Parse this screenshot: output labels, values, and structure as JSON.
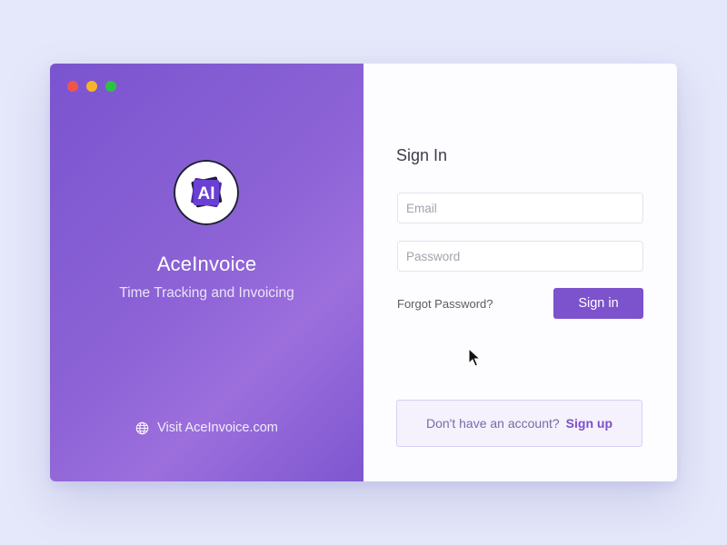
{
  "brand": {
    "app_name": "AceInvoice",
    "tagline": "Time Tracking and Invoicing",
    "logo_text": "AI",
    "visit_link": "Visit AceInvoice.com",
    "visit_icon": "globe-icon"
  },
  "window_controls": [
    "close",
    "minimize",
    "zoom"
  ],
  "form": {
    "title": "Sign In",
    "email_placeholder": "Email",
    "password_placeholder": "Password",
    "forgot_label": "Forgot Password?",
    "signin_label": "Sign in",
    "signup_prompt": "Don't have an account?",
    "signup_label": "Sign up"
  },
  "colors": {
    "background": "#e5e8fa",
    "brand_gradient_start": "#7a54cf",
    "brand_gradient_end": "#9c6fdd",
    "accent": "#7c52cd",
    "signup_box_bg": "#f5f1fd"
  }
}
